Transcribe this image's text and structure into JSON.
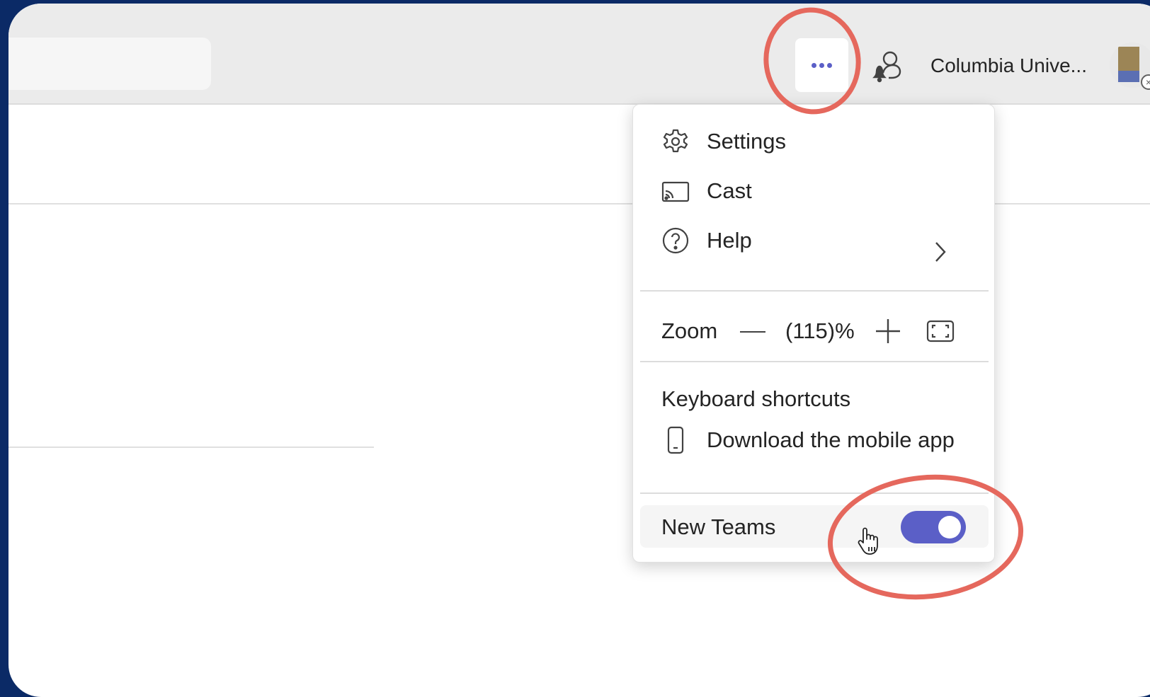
{
  "header": {
    "org_name": "Columbia Unive...",
    "more_button": "more-options",
    "status_badge": "×"
  },
  "menu": {
    "items": [
      {
        "label": "Settings",
        "icon": "gear-icon"
      },
      {
        "label": "Cast",
        "icon": "cast-icon"
      },
      {
        "label": "Help",
        "icon": "help-circle-icon"
      }
    ],
    "zoom": {
      "label": "Zoom",
      "value": "(115)%"
    },
    "keyboard_shortcuts": "Keyboard shortcuts",
    "download_app": {
      "label": "Download the mobile app",
      "icon": "phone-icon"
    },
    "new_teams": {
      "label": "New Teams",
      "enabled": true
    }
  },
  "colors": {
    "accent": "#5b5fc7",
    "annotation": "#e5685d",
    "background": "#0b2a66"
  }
}
